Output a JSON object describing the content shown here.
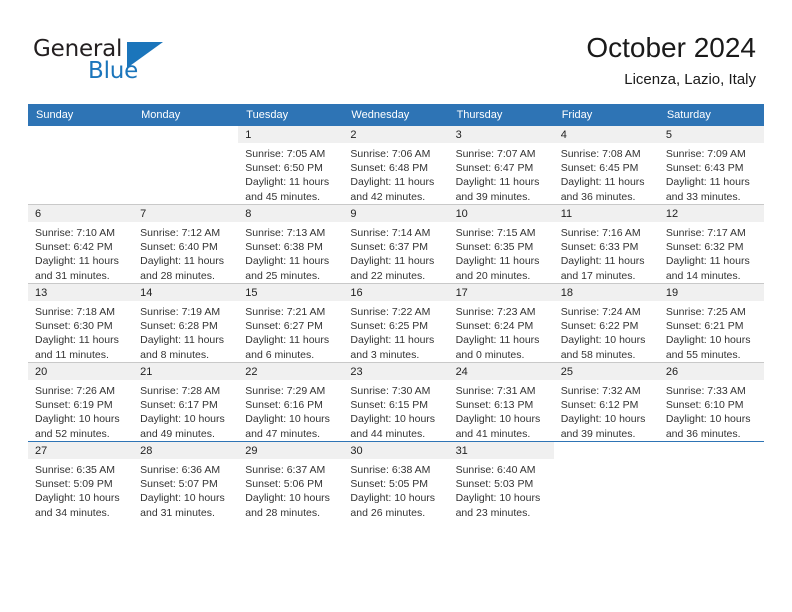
{
  "brand": {
    "name_part1": "General",
    "name_part2": "Blue",
    "logo_icon": "triangle-icon",
    "accent_color": "#1b75bb"
  },
  "header": {
    "title": "October 2024",
    "subtitle": "Licenza, Lazio, Italy"
  },
  "calendar": {
    "header_color": "#2e74b5",
    "weekday_headers": [
      "Sunday",
      "Monday",
      "Tuesday",
      "Wednesday",
      "Thursday",
      "Friday",
      "Saturday"
    ],
    "weeks": [
      [
        {
          "day": "",
          "blank": true
        },
        {
          "day": "",
          "blank": true
        },
        {
          "day": "1",
          "sunrise": "Sunrise: 7:05 AM",
          "sunset": "Sunset: 6:50 PM",
          "daylight": "Daylight: 11 hours and 45 minutes."
        },
        {
          "day": "2",
          "sunrise": "Sunrise: 7:06 AM",
          "sunset": "Sunset: 6:48 PM",
          "daylight": "Daylight: 11 hours and 42 minutes."
        },
        {
          "day": "3",
          "sunrise": "Sunrise: 7:07 AM",
          "sunset": "Sunset: 6:47 PM",
          "daylight": "Daylight: 11 hours and 39 minutes."
        },
        {
          "day": "4",
          "sunrise": "Sunrise: 7:08 AM",
          "sunset": "Sunset: 6:45 PM",
          "daylight": "Daylight: 11 hours and 36 minutes."
        },
        {
          "day": "5",
          "sunrise": "Sunrise: 7:09 AM",
          "sunset": "Sunset: 6:43 PM",
          "daylight": "Daylight: 11 hours and 33 minutes."
        }
      ],
      [
        {
          "day": "6",
          "sunrise": "Sunrise: 7:10 AM",
          "sunset": "Sunset: 6:42 PM",
          "daylight": "Daylight: 11 hours and 31 minutes."
        },
        {
          "day": "7",
          "sunrise": "Sunrise: 7:12 AM",
          "sunset": "Sunset: 6:40 PM",
          "daylight": "Daylight: 11 hours and 28 minutes."
        },
        {
          "day": "8",
          "sunrise": "Sunrise: 7:13 AM",
          "sunset": "Sunset: 6:38 PM",
          "daylight": "Daylight: 11 hours and 25 minutes."
        },
        {
          "day": "9",
          "sunrise": "Sunrise: 7:14 AM",
          "sunset": "Sunset: 6:37 PM",
          "daylight": "Daylight: 11 hours and 22 minutes."
        },
        {
          "day": "10",
          "sunrise": "Sunrise: 7:15 AM",
          "sunset": "Sunset: 6:35 PM",
          "daylight": "Daylight: 11 hours and 20 minutes."
        },
        {
          "day": "11",
          "sunrise": "Sunrise: 7:16 AM",
          "sunset": "Sunset: 6:33 PM",
          "daylight": "Daylight: 11 hours and 17 minutes."
        },
        {
          "day": "12",
          "sunrise": "Sunrise: 7:17 AM",
          "sunset": "Sunset: 6:32 PM",
          "daylight": "Daylight: 11 hours and 14 minutes."
        }
      ],
      [
        {
          "day": "13",
          "sunrise": "Sunrise: 7:18 AM",
          "sunset": "Sunset: 6:30 PM",
          "daylight": "Daylight: 11 hours and 11 minutes."
        },
        {
          "day": "14",
          "sunrise": "Sunrise: 7:19 AM",
          "sunset": "Sunset: 6:28 PM",
          "daylight": "Daylight: 11 hours and 8 minutes."
        },
        {
          "day": "15",
          "sunrise": "Sunrise: 7:21 AM",
          "sunset": "Sunset: 6:27 PM",
          "daylight": "Daylight: 11 hours and 6 minutes."
        },
        {
          "day": "16",
          "sunrise": "Sunrise: 7:22 AM",
          "sunset": "Sunset: 6:25 PM",
          "daylight": "Daylight: 11 hours and 3 minutes."
        },
        {
          "day": "17",
          "sunrise": "Sunrise: 7:23 AM",
          "sunset": "Sunset: 6:24 PM",
          "daylight": "Daylight: 11 hours and 0 minutes."
        },
        {
          "day": "18",
          "sunrise": "Sunrise: 7:24 AM",
          "sunset": "Sunset: 6:22 PM",
          "daylight": "Daylight: 10 hours and 58 minutes."
        },
        {
          "day": "19",
          "sunrise": "Sunrise: 7:25 AM",
          "sunset": "Sunset: 6:21 PM",
          "daylight": "Daylight: 10 hours and 55 minutes."
        }
      ],
      [
        {
          "day": "20",
          "sunrise": "Sunrise: 7:26 AM",
          "sunset": "Sunset: 6:19 PM",
          "daylight": "Daylight: 10 hours and 52 minutes."
        },
        {
          "day": "21",
          "sunrise": "Sunrise: 7:28 AM",
          "sunset": "Sunset: 6:17 PM",
          "daylight": "Daylight: 10 hours and 49 minutes."
        },
        {
          "day": "22",
          "sunrise": "Sunrise: 7:29 AM",
          "sunset": "Sunset: 6:16 PM",
          "daylight": "Daylight: 10 hours and 47 minutes."
        },
        {
          "day": "23",
          "sunrise": "Sunrise: 7:30 AM",
          "sunset": "Sunset: 6:15 PM",
          "daylight": "Daylight: 10 hours and 44 minutes."
        },
        {
          "day": "24",
          "sunrise": "Sunrise: 7:31 AM",
          "sunset": "Sunset: 6:13 PM",
          "daylight": "Daylight: 10 hours and 41 minutes."
        },
        {
          "day": "25",
          "sunrise": "Sunrise: 7:32 AM",
          "sunset": "Sunset: 6:12 PM",
          "daylight": "Daylight: 10 hours and 39 minutes."
        },
        {
          "day": "26",
          "sunrise": "Sunrise: 7:33 AM",
          "sunset": "Sunset: 6:10 PM",
          "daylight": "Daylight: 10 hours and 36 minutes."
        }
      ],
      [
        {
          "day": "27",
          "sunrise": "Sunrise: 6:35 AM",
          "sunset": "Sunset: 5:09 PM",
          "daylight": "Daylight: 10 hours and 34 minutes."
        },
        {
          "day": "28",
          "sunrise": "Sunrise: 6:36 AM",
          "sunset": "Sunset: 5:07 PM",
          "daylight": "Daylight: 10 hours and 31 minutes."
        },
        {
          "day": "29",
          "sunrise": "Sunrise: 6:37 AM",
          "sunset": "Sunset: 5:06 PM",
          "daylight": "Daylight: 10 hours and 28 minutes."
        },
        {
          "day": "30",
          "sunrise": "Sunrise: 6:38 AM",
          "sunset": "Sunset: 5:05 PM",
          "daylight": "Daylight: 10 hours and 26 minutes."
        },
        {
          "day": "31",
          "sunrise": "Sunrise: 6:40 AM",
          "sunset": "Sunset: 5:03 PM",
          "daylight": "Daylight: 10 hours and 23 minutes."
        },
        {
          "day": "",
          "blank": true
        },
        {
          "day": "",
          "blank": true
        }
      ]
    ]
  }
}
